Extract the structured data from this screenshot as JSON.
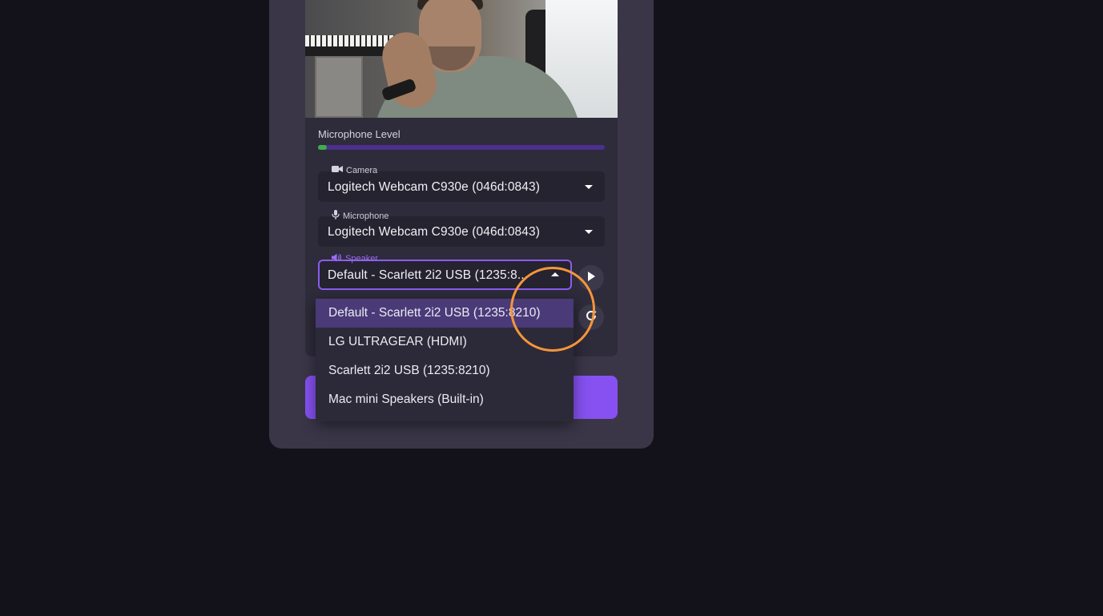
{
  "microphone_level": {
    "label": "Microphone Level",
    "level_fraction": 0.03,
    "fill_color": "#3fae4a",
    "track_color": "#4b2f8c"
  },
  "devices": {
    "camera": {
      "label": "Camera",
      "icon": "video-camera-icon",
      "value": "Logitech Webcam C930e (046d:0843)"
    },
    "microphone": {
      "label": "Microphone",
      "icon": "microphone-icon",
      "value": "Logitech Webcam C930e (046d:0843)"
    },
    "speaker": {
      "label": "Speaker",
      "icon": "speaker-icon",
      "value": "Default - Scarlett 2i2 USB (1235:8..."
    }
  },
  "speaker_options": [
    "Default - Scarlett 2i2 USB (1235:8210)",
    "LG ULTRAGEAR (HDMI)",
    "Scarlett 2i2 USB (1235:8210)",
    "Mac mini Speakers (Built-in)"
  ],
  "speaker_selected_index": 0,
  "buttons": {
    "play_test": "play-icon",
    "refresh": "refresh-icon"
  },
  "colors": {
    "accent": "#8651f0",
    "focus_border": "#8a5cf0",
    "selected_option": "#4a3a78",
    "cursor_highlight": "#f5953a"
  }
}
